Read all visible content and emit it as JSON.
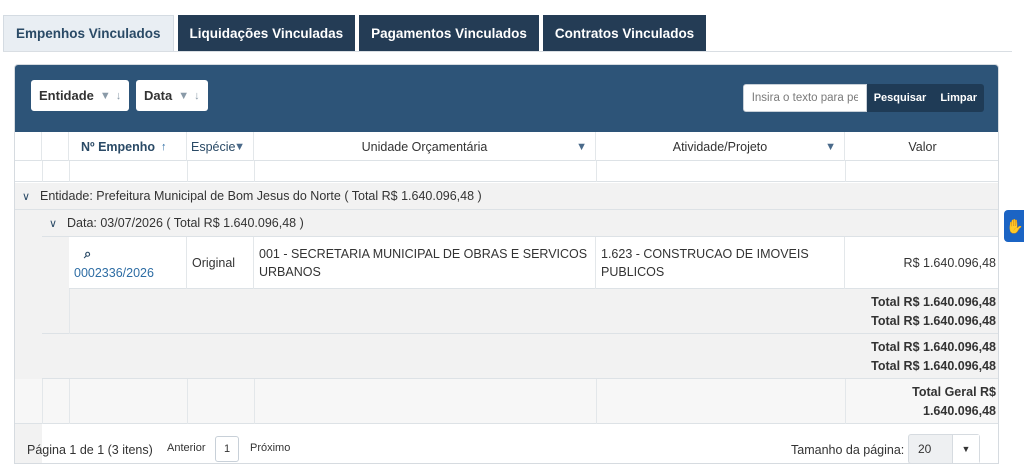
{
  "tabs": [
    {
      "label": "Empenhos Vinculados"
    },
    {
      "label": "Liquidações Vinculadas"
    },
    {
      "label": "Pagamentos Vinculados"
    },
    {
      "label": "Contratos Vinculados"
    }
  ],
  "toolbar": {
    "group_chips": [
      {
        "label": "Entidade"
      },
      {
        "label": "Data"
      }
    ],
    "search_placeholder": "Insira o texto para pe",
    "search_button": "Pesquisar",
    "clear_button": "Limpar"
  },
  "columns": {
    "empenho": "Nº Empenho",
    "especie": "Espécie",
    "unidade": "Unidade Orçamentária",
    "atividade": "Atividade/Projeto",
    "valor": "Valor"
  },
  "group_entity": "Entidade: Prefeitura Municipal de Bom Jesus do Norte ( Total R$ 1.640.096,48 )",
  "group_date": "Data: 03/07/2026 ( Total R$ 1.640.096,48 )",
  "row": {
    "empenho": "0002336/2026",
    "especie": "Original",
    "unidade_line1": "001 - SECRETARIA MUNICIPAL DE OBRAS E SERVICOS",
    "unidade_line2": "URBANOS",
    "atividade_line1": "1.623 - CONSTRUCAO DE IMOVEIS",
    "atividade_line2": "PUBLICOS",
    "valor": "R$ 1.640.096,48"
  },
  "summaries": {
    "date_total_1": "Total R$ 1.640.096,48",
    "date_total_2": "Total R$ 1.640.096,48",
    "entity_total_1": "Total R$ 1.640.096,48",
    "entity_total_2": "Total R$ 1.640.096,48",
    "grand_total_1": "Total Geral R$",
    "grand_total_2": "1.640.096,48"
  },
  "pager": {
    "info": "Página 1 de 1 (3 itens)",
    "prev": "Anterior",
    "page": "1",
    "next": "Próximo",
    "size_label": "Tamanho da página:",
    "size_value": "20"
  },
  "colors": {
    "toolbar": "#2d5478",
    "tab_inactive": "#243c55",
    "accent": "#2e6da4"
  }
}
